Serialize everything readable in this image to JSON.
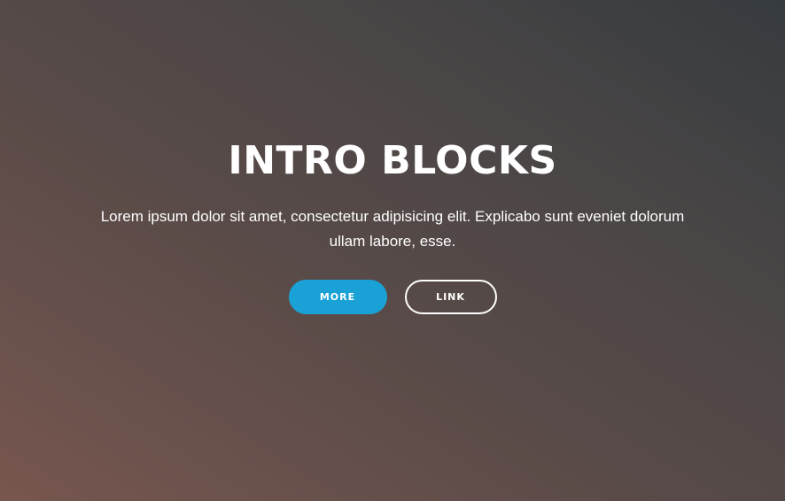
{
  "hero": {
    "title": "INTRO BLOCKS",
    "subtitle": "Lorem ipsum dolor sit amet, consectetur adipisicing elit. Explicabo sunt eveniet dolorum ullam labore, esse.",
    "buttons": {
      "more_label": "MORE",
      "link_label": "LINK"
    }
  },
  "colors": {
    "primary_button": "#1aa2d6",
    "text": "#ffffff",
    "gradient_bottom_left": "#77564f",
    "gradient_top_right": "#363b3f"
  }
}
